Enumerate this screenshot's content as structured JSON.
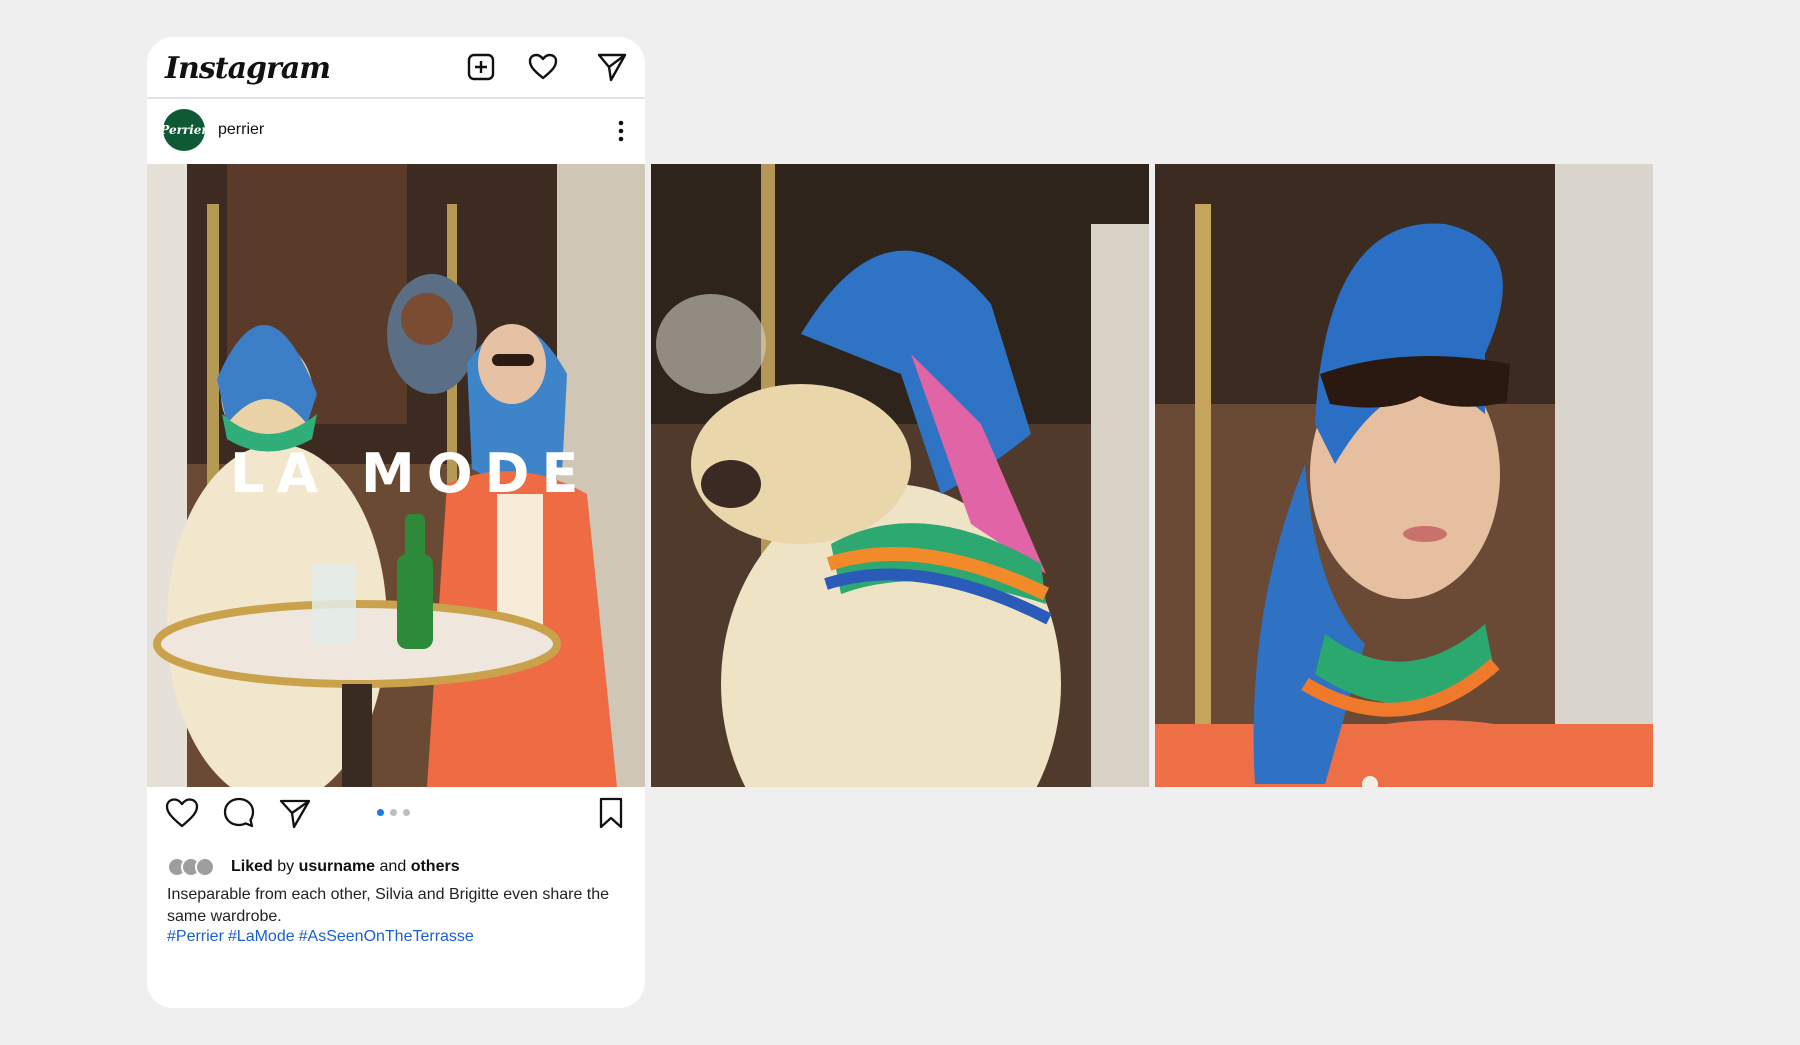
{
  "app": {
    "name": "Instagram"
  },
  "post": {
    "username": "perrier",
    "avatar_text": "Perrier",
    "overlay_title": "LA MODE",
    "liked_prefix": "Liked",
    "liked_by": "by",
    "liked_user": "usurname",
    "liked_and": "and",
    "liked_others": "others",
    "caption": "Inseparable from each other, Silvia and Brigitte even share the same wardrobe.",
    "hashtags": [
      "#Perrier",
      "#LaMode",
      "#AsSeenOnTheTerrasse"
    ],
    "carousel": {
      "count": 3,
      "active_index": 0
    }
  },
  "icons": {
    "top": [
      "new-post-icon",
      "heart-icon",
      "send-icon"
    ],
    "actions": [
      "like-icon",
      "comment-icon",
      "share-icon",
      "bookmark-icon"
    ]
  },
  "colors": {
    "link": "#1a5fd0",
    "carousel_active": "#1877f2",
    "avatar_bg": "#0f5a35"
  }
}
